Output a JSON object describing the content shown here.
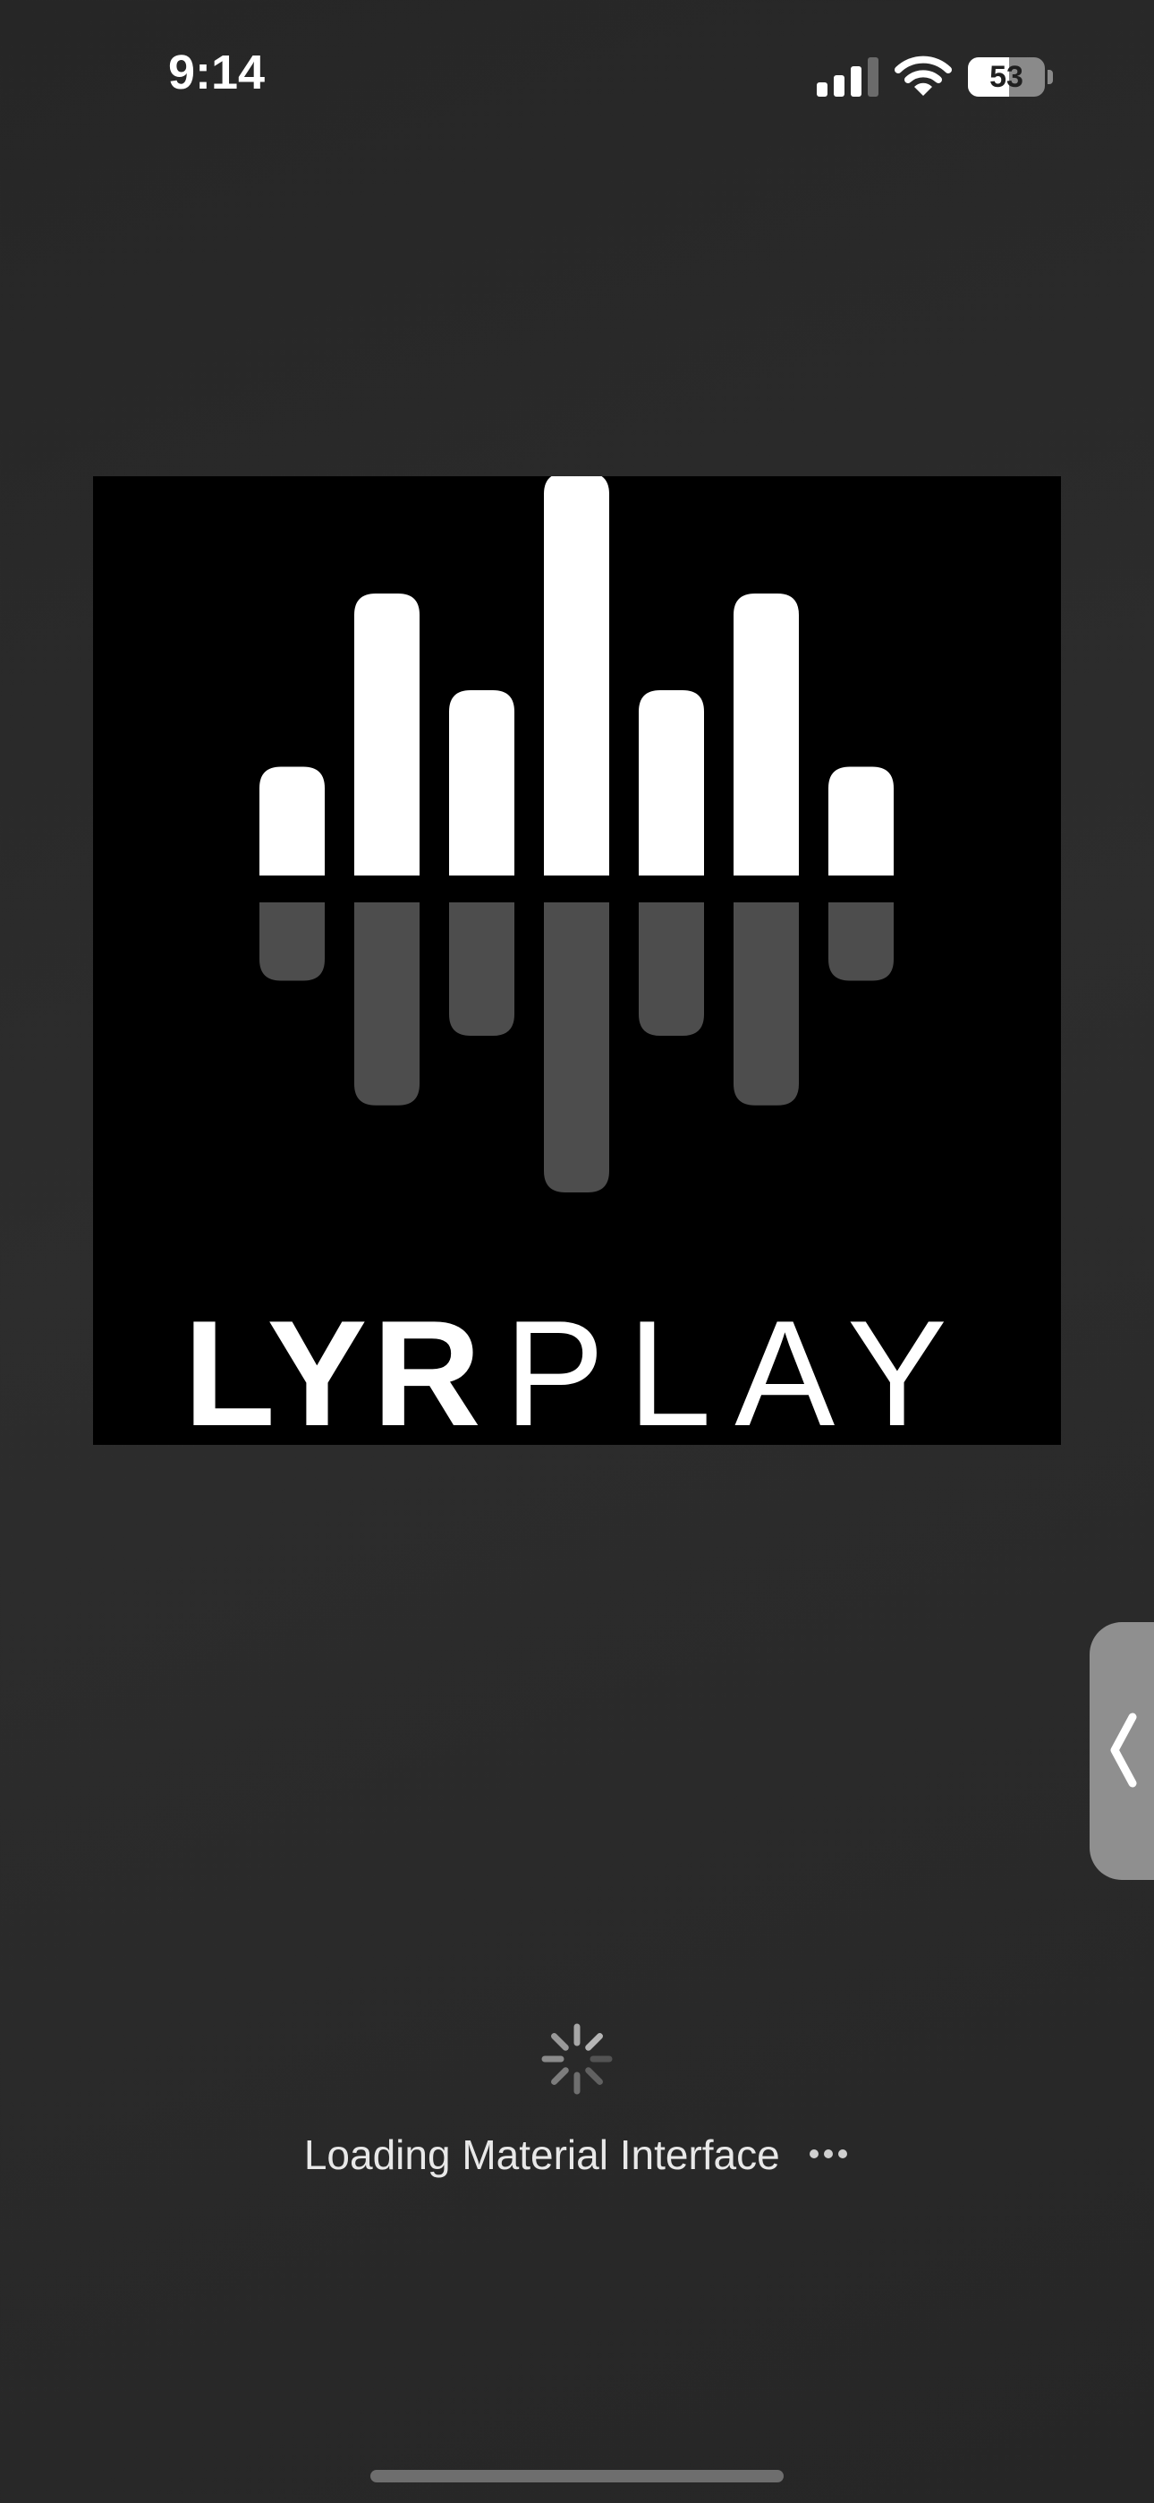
{
  "status_bar": {
    "time": "9:14",
    "battery_percent": "53",
    "battery_level": 0.53,
    "icons": [
      "cellular-signal-icon",
      "wifi-icon",
      "battery-icon"
    ]
  },
  "logo": {
    "word_bold": "LYR",
    "word_light": "PLAY",
    "bar_levels": [
      0.27,
      0.7,
      0.46,
      1.0,
      0.46,
      0.7,
      0.27
    ],
    "colors": {
      "background": "#000000",
      "bar": "#ffffff",
      "reflection": "#4d4d4d"
    }
  },
  "side_handle": {
    "icon": "chevron-left-icon"
  },
  "loading": {
    "spinner_icon": "activity-spinner-icon",
    "text": "Loading Material Interface",
    "dots_icon": "ellipsis-icon"
  },
  "colors": {
    "background": "#2a2a2a",
    "text": "#e8e8e8"
  }
}
